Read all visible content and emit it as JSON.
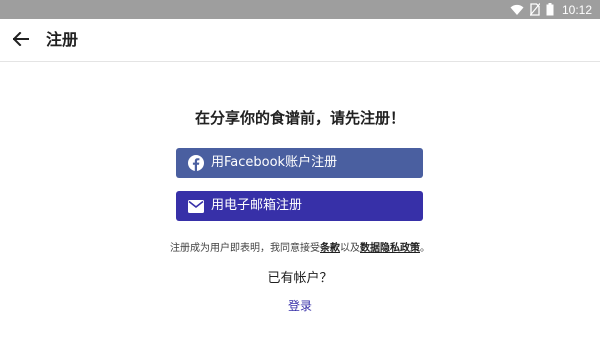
{
  "status_bar": {
    "time": "10:12",
    "icons": [
      "wifi-icon",
      "no-sim-icon",
      "battery-icon"
    ]
  },
  "app_bar": {
    "back_icon": "back-arrow-icon",
    "title": "注册"
  },
  "signup": {
    "headline": "在分享你的食谱前，请先注册！",
    "facebook_button": {
      "icon": "facebook-icon",
      "label": "用Facebook账户注册",
      "color": "#4a5fa0"
    },
    "email_button": {
      "icon": "envelope-icon",
      "label": "用电子邮箱注册",
      "color": "#3730a8"
    }
  },
  "terms": {
    "prefix": "注册成为用户即表明，我同意接受",
    "terms_link": "条款",
    "middle": "以及",
    "privacy_link": "数据隐私政策",
    "suffix": "。"
  },
  "login": {
    "prompt": "已有帐户？",
    "link_label": "登录",
    "link_color": "#3730a8"
  }
}
